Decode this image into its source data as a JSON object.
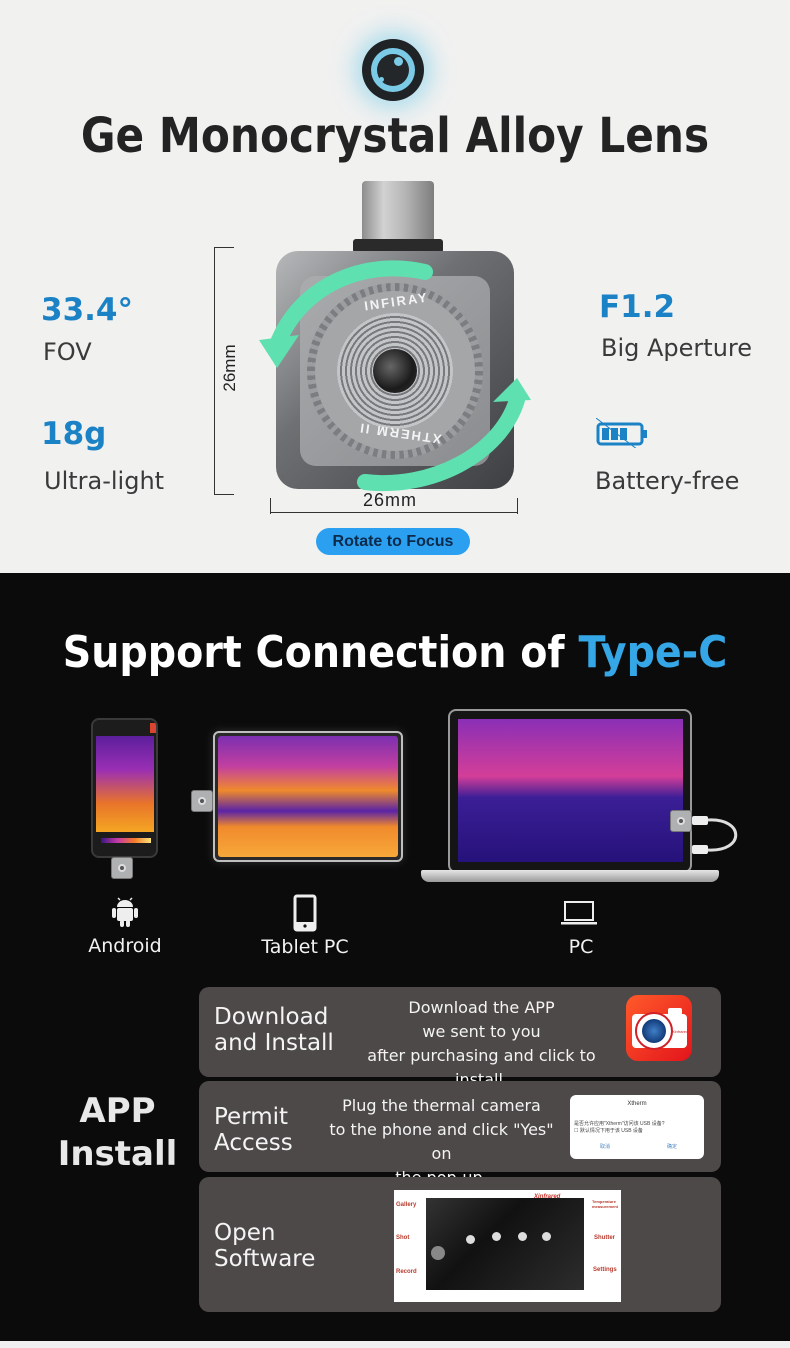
{
  "hero": {
    "title": "Ge Monocrystal Alloy Lens",
    "badge_icon": "lens-icon",
    "specs_left": [
      {
        "value": "33.4°",
        "label": "FOV"
      },
      {
        "value": "18g",
        "label": "Ultra-light"
      }
    ],
    "specs_right": [
      {
        "value": "F1.2",
        "label": "Big Aperture"
      },
      {
        "icon": "battery-free-icon",
        "label": "Battery-free"
      }
    ],
    "dimension_height": "26mm",
    "dimension_width": "26mm",
    "lens_brand_top": "INFIRAY",
    "lens_brand_bottom": "XTHERM II",
    "focus_pill": "Rotate to Focus",
    "accent_color": "#1b82c6",
    "arrow_color": "#5fe0b0"
  },
  "connection": {
    "title_main": "Support Connection of ",
    "title_accent": "Type-C",
    "accent_color": "#35a6e6",
    "devices": [
      {
        "icon": "android-icon",
        "label": "Android"
      },
      {
        "icon": "tablet-icon",
        "label": "Tablet PC"
      },
      {
        "icon": "laptop-icon",
        "label": "PC"
      }
    ]
  },
  "app_install": {
    "heading_line1": "APP",
    "heading_line2": "Install",
    "steps": [
      {
        "title_line1": "Download",
        "title_line2": "and Install",
        "desc": [
          "Download the APP",
          "we sent to you",
          "after purchasing and click to install."
        ],
        "icon": "xtherm-app-icon",
        "icon_text": "Xinfrared"
      },
      {
        "title_line1": "Permit",
        "title_line2": "Access",
        "desc": [
          "Plug the thermal camera",
          "to the phone and click \"Yes\" on",
          "the pop-up."
        ],
        "popup": {
          "title": "Xtherm",
          "question": "是否允许应用\"Xtherm\"访问该 USB 设备?",
          "checkbox": "默认情况下用于该 USB 设备",
          "cancel": "取消",
          "confirm": "确定"
        }
      },
      {
        "title_line1": "Open",
        "title_line2": "Software",
        "screenshot_labels": {
          "gallery": "Gallery",
          "shot": "Shot",
          "record": "Record",
          "temperature": "Temperature measurement",
          "shutter": "Shutter",
          "settings": "Settings",
          "brand": "Xinfrared"
        }
      }
    ]
  }
}
